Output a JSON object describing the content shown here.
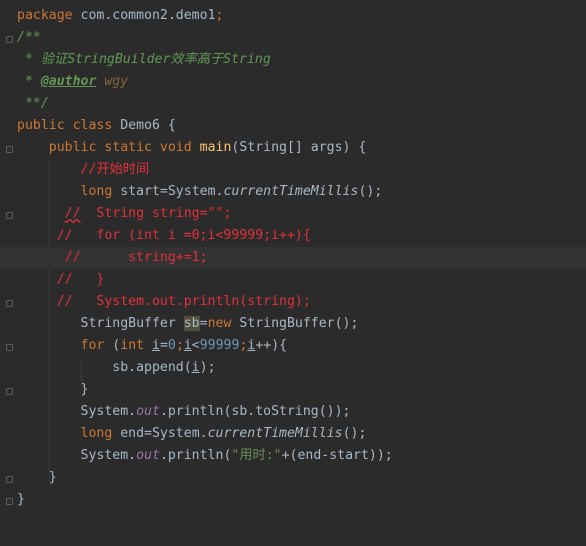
{
  "lines": [
    {
      "segs": [
        [
          "kw",
          "package "
        ],
        [
          "",
          "com.common2.demo1"
        ],
        [
          "kw",
          ";"
        ]
      ]
    },
    {
      "segs": [
        [
          "cm",
          "/**"
        ]
      ]
    },
    {
      "segs": [
        [
          "cm",
          " * 验证StringBuilder效率高于String"
        ]
      ]
    },
    {
      "segs": [
        [
          "cm",
          " * "
        ],
        [
          "cmtag",
          "@author"
        ],
        [
          "cmtagtext",
          " wgy"
        ]
      ]
    },
    {
      "segs": [
        [
          "cm",
          " **/"
        ]
      ]
    },
    {
      "segs": [
        [
          "kw",
          "public class "
        ],
        [
          "",
          "Demo6 {"
        ]
      ]
    },
    {
      "segs": [
        [
          "",
          "    "
        ],
        [
          "kw",
          "public static void "
        ],
        [
          "mth",
          "main"
        ],
        [
          "",
          "(String[] args) {"
        ]
      ]
    },
    {
      "segs": [
        [
          "",
          "        "
        ],
        [
          "lc",
          "//开始时间"
        ]
      ]
    },
    {
      "segs": [
        [
          "",
          "        "
        ],
        [
          "kw",
          "long "
        ],
        [
          "",
          "start=System."
        ],
        [
          "ital",
          "currentTimeMillis"
        ],
        [
          "",
          "();"
        ]
      ]
    },
    {
      "segs": [
        [
          "",
          "      "
        ],
        [
          "lc squiggle",
          "//"
        ],
        [
          "lc",
          "  String string=\"\";"
        ]
      ]
    },
    {
      "segs": [
        [
          "",
          "     "
        ],
        [
          "lc",
          "//   for (int i =0;i<99999;i++){"
        ]
      ]
    },
    {
      "segs": [
        [
          "",
          "      "
        ],
        [
          "lc",
          "//      string+=1;"
        ]
      ]
    },
    {
      "segs": [
        [
          "",
          "     "
        ],
        [
          "lc",
          "//   }"
        ]
      ]
    },
    {
      "segs": [
        [
          "",
          "     "
        ],
        [
          "lc",
          "//   System.out.println(string);"
        ]
      ]
    },
    {
      "segs": [
        [
          "",
          "        StringBuffer "
        ],
        [
          "sbhl",
          "sb"
        ],
        [
          "",
          "="
        ],
        [
          "kw",
          "new "
        ],
        [
          "",
          "StringBuffer();"
        ]
      ]
    },
    {
      "segs": [
        [
          "",
          "        "
        ],
        [
          "kw",
          "for "
        ],
        [
          "",
          "("
        ],
        [
          "kw",
          "int "
        ],
        [
          "und",
          "i"
        ],
        [
          "",
          "="
        ],
        [
          "num",
          "0"
        ],
        [
          "kw",
          ";"
        ],
        [
          "und",
          "i"
        ],
        [
          "",
          "<"
        ],
        [
          "num",
          "99999"
        ],
        [
          "kw",
          ";"
        ],
        [
          "und",
          "i"
        ],
        [
          "",
          "++){"
        ]
      ]
    },
    {
      "segs": [
        [
          "",
          "            sb.append("
        ],
        [
          "und",
          "i"
        ],
        [
          "",
          ");"
        ]
      ]
    },
    {
      "segs": [
        [
          "",
          "        }"
        ]
      ]
    },
    {
      "segs": [
        [
          "",
          "        System."
        ],
        [
          "field",
          "out"
        ],
        [
          "",
          ".println(sb.toString());"
        ]
      ]
    },
    {
      "segs": [
        [
          "",
          "        "
        ],
        [
          "kw",
          "long "
        ],
        [
          "",
          "end=System."
        ],
        [
          "ital",
          "currentTimeMillis"
        ],
        [
          "",
          "();"
        ]
      ]
    },
    {
      "segs": [
        [
          "",
          "        System."
        ],
        [
          "field",
          "out"
        ],
        [
          "",
          ".println("
        ],
        [
          "str",
          "\"用时:\""
        ],
        [
          "",
          "+(end-start));"
        ]
      ]
    },
    {
      "segs": [
        [
          "",
          "    }"
        ]
      ]
    },
    {
      "segs": [
        [
          "",
          "}"
        ]
      ]
    }
  ],
  "highlight_line": 11,
  "icons": {
    "gutter_hint": "lightbulb-icon",
    "fold": "fold-marker-icon"
  }
}
